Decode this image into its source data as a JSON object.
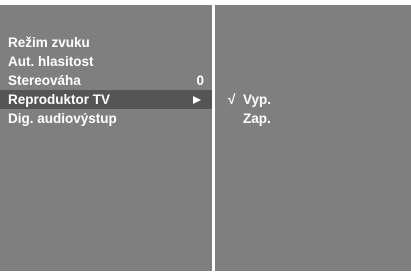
{
  "menu": {
    "items": [
      {
        "label": "Režim zvuku"
      },
      {
        "label": "Aut. hlasitost"
      },
      {
        "label": "Stereováha",
        "value": "0"
      },
      {
        "label": "Reproduktor TV"
      },
      {
        "label": "Dig. audiovýstup"
      }
    ]
  },
  "submenu": {
    "check_glyph": "√",
    "options": [
      {
        "label": "Vyp."
      },
      {
        "label": "Zap."
      }
    ]
  },
  "colors": {
    "panel": "#7f7f7f",
    "selected": "#555555",
    "text": "#ffffff",
    "background": "#ffffff"
  },
  "icons": {
    "submenu_arrow": "right-triangle-icon",
    "check": "check-icon"
  }
}
